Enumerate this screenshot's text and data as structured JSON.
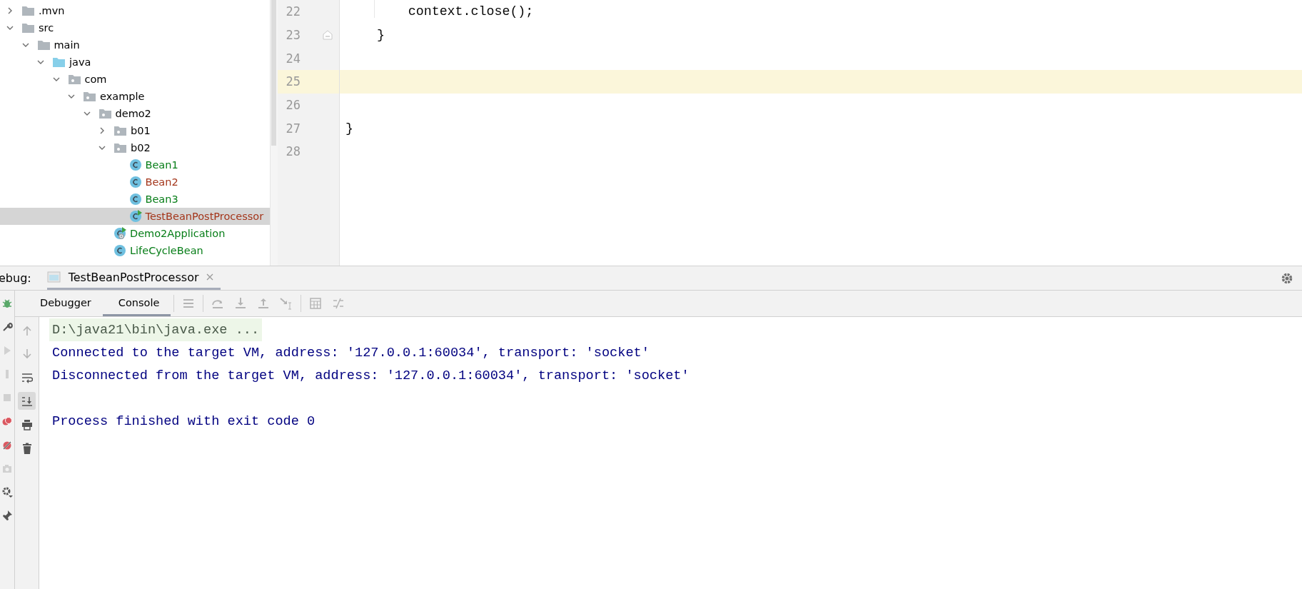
{
  "project_tree": {
    "items": [
      {
        "label": ".mvn",
        "kind": "folder",
        "expanded": false,
        "selected": false
      },
      {
        "label": "src",
        "kind": "folder",
        "expanded": true,
        "selected": false,
        "children": [
          {
            "label": "main",
            "kind": "folder",
            "expanded": true,
            "selected": false,
            "children": [
              {
                "label": "java",
                "kind": "source-root",
                "expanded": true,
                "selected": false,
                "children": [
                  {
                    "label": "com",
                    "kind": "package",
                    "expanded": true,
                    "selected": false,
                    "children": [
                      {
                        "label": "example",
                        "kind": "package",
                        "expanded": true,
                        "selected": false,
                        "children": [
                          {
                            "label": "demo2",
                            "kind": "package",
                            "expanded": true,
                            "selected": false,
                            "children": [
                              {
                                "label": "b01",
                                "kind": "package",
                                "expanded": false,
                                "selected": false
                              },
                              {
                                "label": "b02",
                                "kind": "package",
                                "expanded": true,
                                "selected": false,
                                "children": [
                                  {
                                    "label": "Bean1",
                                    "kind": "class",
                                    "color": "#067d17",
                                    "selected": false
                                  },
                                  {
                                    "label": "Bean2",
                                    "kind": "class",
                                    "color": "#a4361b",
                                    "selected": false
                                  },
                                  {
                                    "label": "Bean3",
                                    "kind": "class",
                                    "color": "#067d17",
                                    "selected": false
                                  },
                                  {
                                    "label": "TestBeanPostProcessor",
                                    "kind": "runnable-class",
                                    "color": "#a4361b",
                                    "selected": true
                                  }
                                ]
                              },
                              {
                                "label": "Demo2Application",
                                "kind": "app-class",
                                "color": "#067d17",
                                "selected": false
                              },
                              {
                                "label": "LifeCycleBean",
                                "kind": "class",
                                "color": "#067d17",
                                "selected": false
                              }
                            ]
                          }
                        ]
                      }
                    ]
                  }
                ]
              }
            ]
          }
        ]
      }
    ]
  },
  "editor": {
    "lines": [
      {
        "number": "22",
        "code": "        context.close();",
        "current": false,
        "fold": false
      },
      {
        "number": "23",
        "code": "    }",
        "current": false,
        "fold": true
      },
      {
        "number": "24",
        "current": false,
        "fold": false
      },
      {
        "number": "25",
        "current": true,
        "fold": false
      },
      {
        "number": "26",
        "current": false,
        "fold": false
      },
      {
        "number": "27",
        "code": "}",
        "current": false,
        "fold": false
      },
      {
        "number": "28",
        "current": false,
        "fold": false
      }
    ]
  },
  "debug_panel": {
    "label": "ebug:",
    "session_tab": {
      "label": "TestBeanPostProcessor",
      "selected": true
    },
    "actions": [
      {
        "kind": "bug",
        "disabled": false
      },
      {
        "kind": "wrench",
        "disabled": false
      },
      {
        "kind": "resume",
        "disabled": true
      },
      {
        "kind": "pause",
        "disabled": true
      },
      {
        "kind": "stop",
        "disabled": true
      },
      {
        "kind": "breakpoints",
        "disabled": false
      },
      {
        "kind": "mute",
        "disabled": false
      },
      {
        "kind": "camera",
        "disabled": true
      },
      {
        "kind": "settings",
        "disabled": false
      },
      {
        "kind": "pin",
        "disabled": false
      }
    ],
    "tabs": [
      {
        "label": "Debugger",
        "selected": false
      },
      {
        "label": "Console",
        "selected": true
      }
    ],
    "toolbar": [
      {
        "kind": "threads",
        "disabled": true
      },
      {
        "kind": "step-over",
        "disabled": true
      },
      {
        "kind": "step-into",
        "disabled": true
      },
      {
        "kind": "step-out",
        "disabled": true
      },
      {
        "kind": "run-to-cursor",
        "disabled": true
      },
      {
        "kind": "evaluate",
        "disabled": true
      },
      {
        "kind": "trace",
        "disabled": true
      }
    ],
    "console_tools": [
      {
        "kind": "up",
        "disabled": true,
        "selected": false
      },
      {
        "kind": "down",
        "disabled": true,
        "selected": false
      },
      {
        "kind": "wrap",
        "disabled": false,
        "selected": false
      },
      {
        "kind": "scroll-end",
        "disabled": false,
        "selected": true
      },
      {
        "kind": "print",
        "disabled": false,
        "selected": false
      },
      {
        "kind": "clear",
        "disabled": false,
        "selected": false
      }
    ],
    "console": [
      {
        "kind": "command",
        "text": "D:\\java21\\bin\\java.exe ..."
      },
      {
        "kind": "output",
        "text": "Connected to the target VM, address: '127.0.0.1:60034', transport: 'socket'"
      },
      {
        "kind": "output",
        "text": "Disconnected from the target VM, address: '127.0.0.1:60034', transport: 'socket'"
      },
      {
        "kind": "blank"
      },
      {
        "kind": "output",
        "text": "Process finished with exit code 0"
      }
    ]
  }
}
